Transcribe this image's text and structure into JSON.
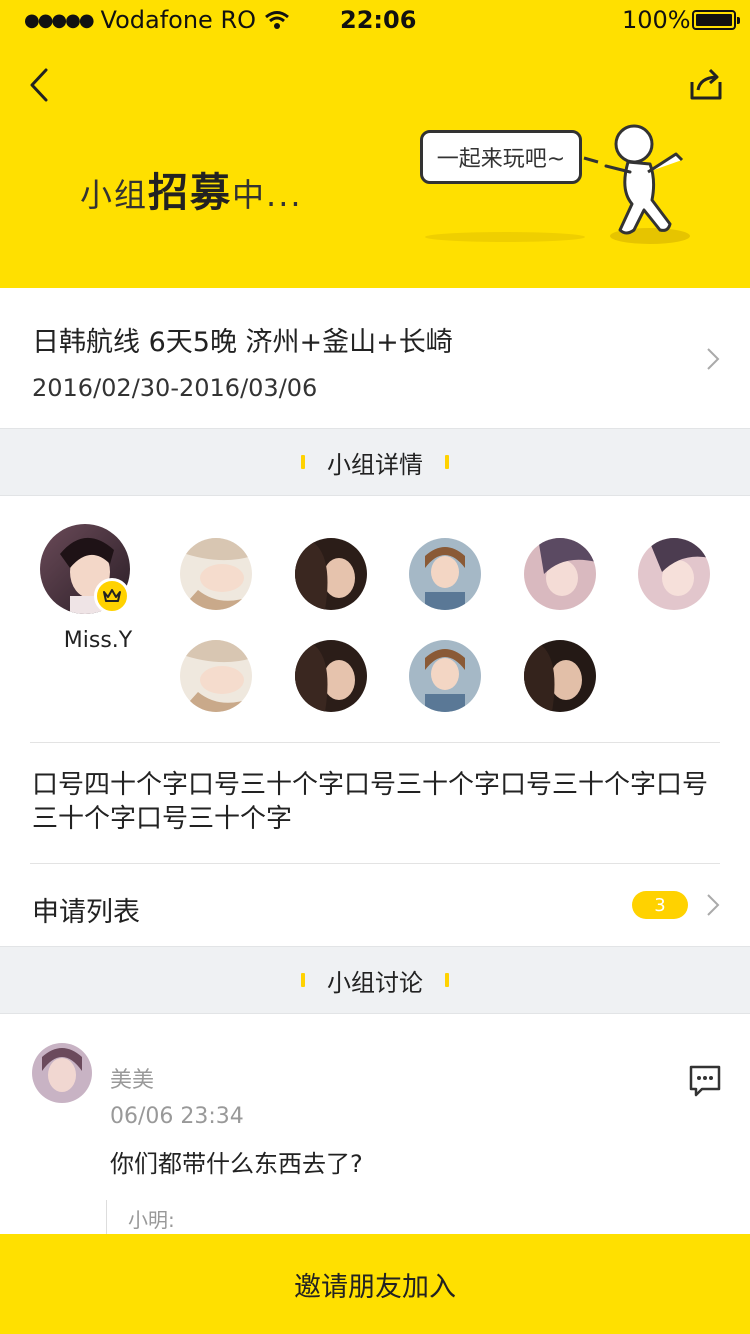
{
  "status_bar": {
    "carrier": "Vodafone RO",
    "time": "22:06",
    "battery": "100%"
  },
  "header": {
    "recruit_prefix": "小组",
    "recruit_big": "招募",
    "recruit_suffix": "中...",
    "bubble_text": "一起来玩吧~",
    "accent_color": "#FFE000"
  },
  "trip": {
    "title": "日韩航线 6天5晚 济州+釜山+长崎",
    "date_range": "2016/02/30-2016/03/06"
  },
  "section_details": "小组详情",
  "leader": {
    "name": "Miss.Y"
  },
  "members": [
    {
      "tone": "light"
    },
    {
      "tone": "dark"
    },
    {
      "tone": "light2"
    },
    {
      "tone": "pink"
    },
    {
      "tone": "pink2"
    },
    {
      "tone": "light"
    },
    {
      "tone": "dark"
    },
    {
      "tone": "light2"
    },
    {
      "tone": "dark2"
    }
  ],
  "slogan": "口号四十个字口号三十个字口号三十个字口号三十个字口号三十个字口号三十个字",
  "apply": {
    "label": "申请列表",
    "count": "3"
  },
  "section_discussion": "小组讨论",
  "comment": {
    "name": "美美",
    "time": "06/06 23:34",
    "text": "你们都带什么东西去了?",
    "reply_author": "小明:"
  },
  "invite_button": "邀请朋友加入"
}
